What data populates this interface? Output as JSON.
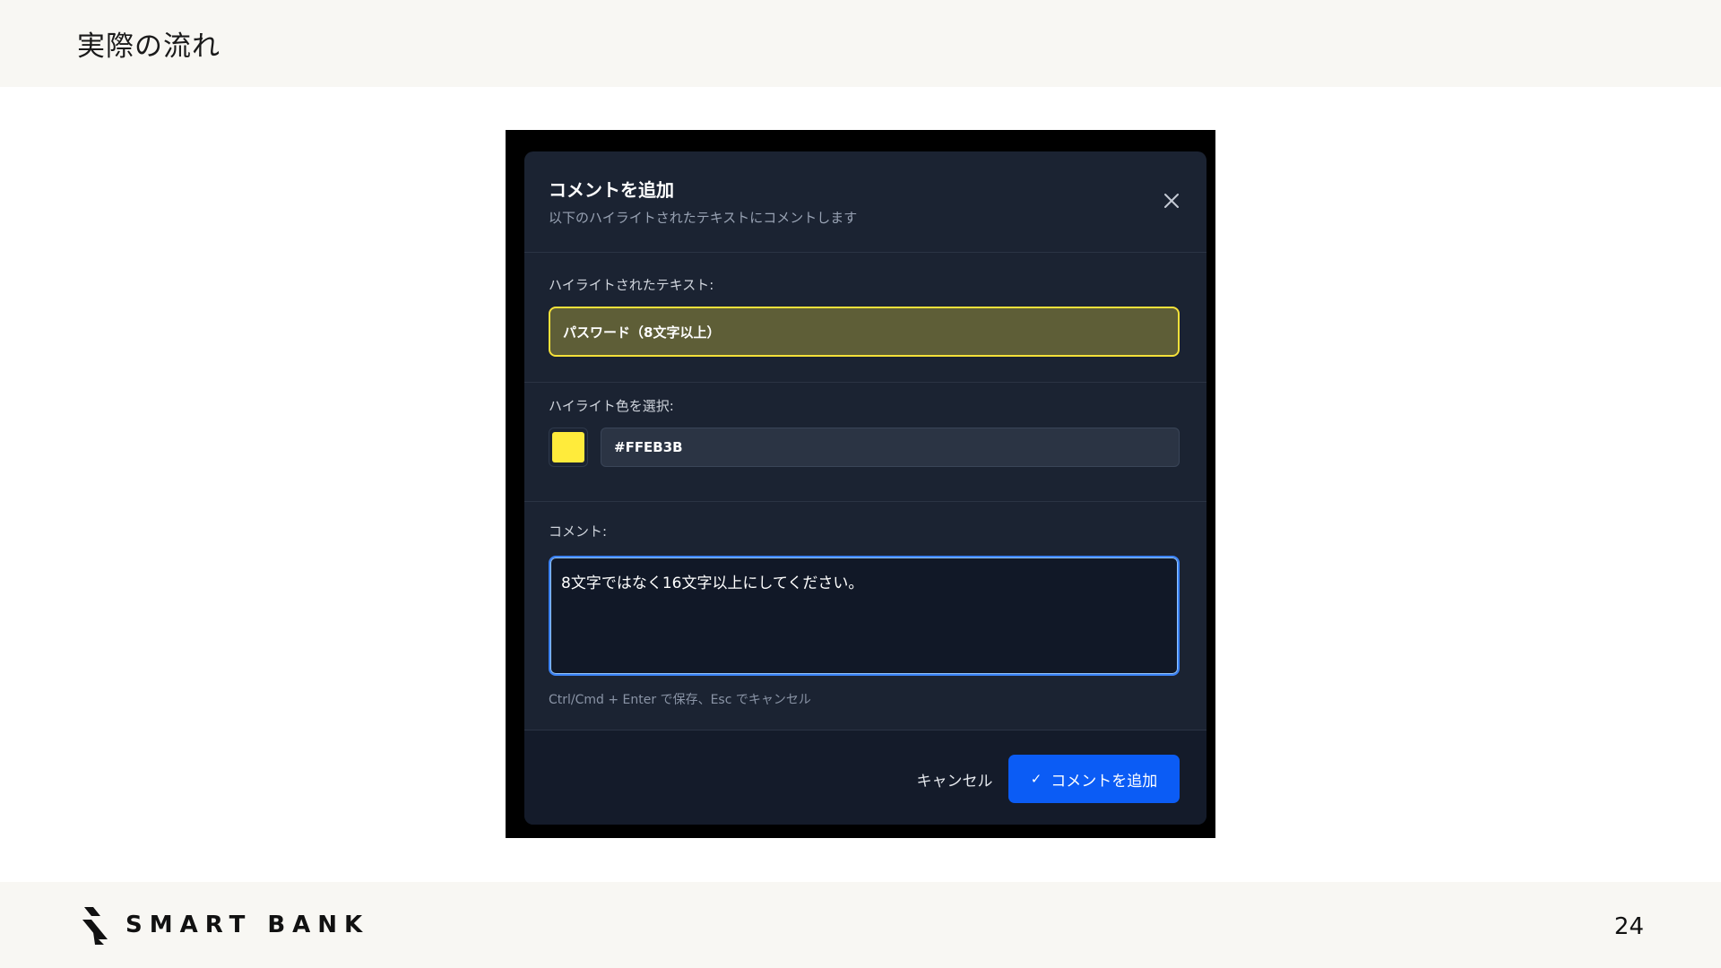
{
  "slide": {
    "title": "実際の流れ",
    "page_number": "24",
    "logo_text": "SMART BANK"
  },
  "modal": {
    "title": "コメントを追加",
    "subtitle": "以下のハイライトされたテキストにコメントします",
    "highlighted_label": "ハイライトされたテキスト:",
    "highlighted_text": "パスワード（8文字以上）",
    "color_label": "ハイライト色を選択:",
    "color_value": "#FFEB3B",
    "comment_label": "コメント:",
    "comment_value": "8文字ではなく16文字以上にしてください。",
    "hint": "Ctrl/Cmd + Enter で保存、Esc でキャンセル",
    "cancel_label": "キャンセル",
    "submit_label": "コメントを追加",
    "submit_icon": "check-icon",
    "close_icon": "close-icon"
  },
  "colors": {
    "accent": "#0b5cf5",
    "highlight": "#FFEB3B",
    "modal_bg": "#1b2332"
  }
}
